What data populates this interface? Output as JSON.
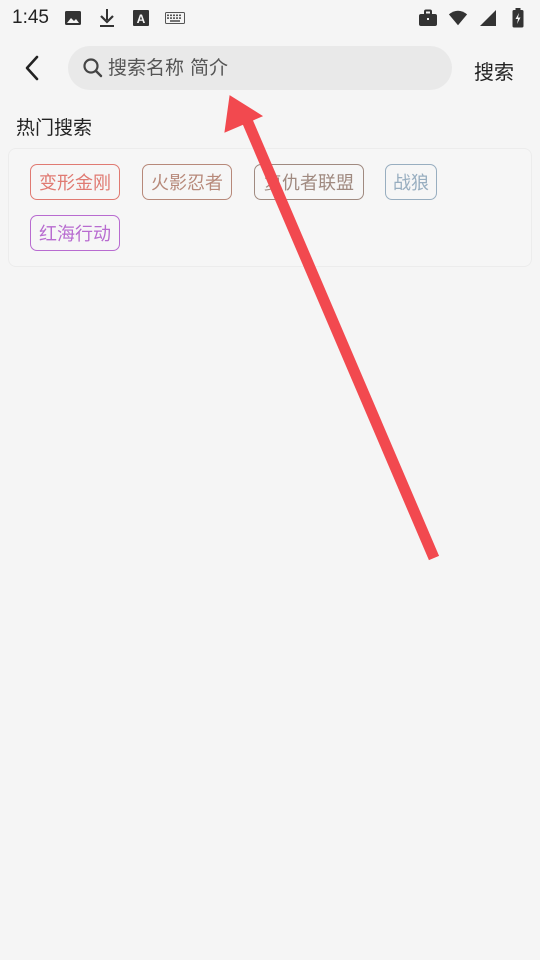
{
  "status_bar": {
    "time": "1:45",
    "left_icons": [
      "image-icon",
      "download-icon",
      "font-a-icon",
      "keyboard-icon"
    ],
    "right_icons": [
      "briefcase-icon",
      "wifi-icon",
      "signal-icon",
      "battery-icon"
    ]
  },
  "header": {
    "search_placeholder": "搜索名称 简介",
    "search_button_label": "搜索"
  },
  "hot_search": {
    "title": "热门搜索",
    "tags": [
      {
        "label": "变形金刚",
        "color": "#e07a72"
      },
      {
        "label": "火影忍者",
        "color": "#b7897a"
      },
      {
        "label": "复仇者联盟",
        "color": "#a08a80"
      },
      {
        "label": "战狼",
        "color": "#98aec0"
      },
      {
        "label": "红海行动",
        "color": "#b86bd0"
      }
    ]
  },
  "annotation": {
    "arrow_color": "#f2494f"
  }
}
